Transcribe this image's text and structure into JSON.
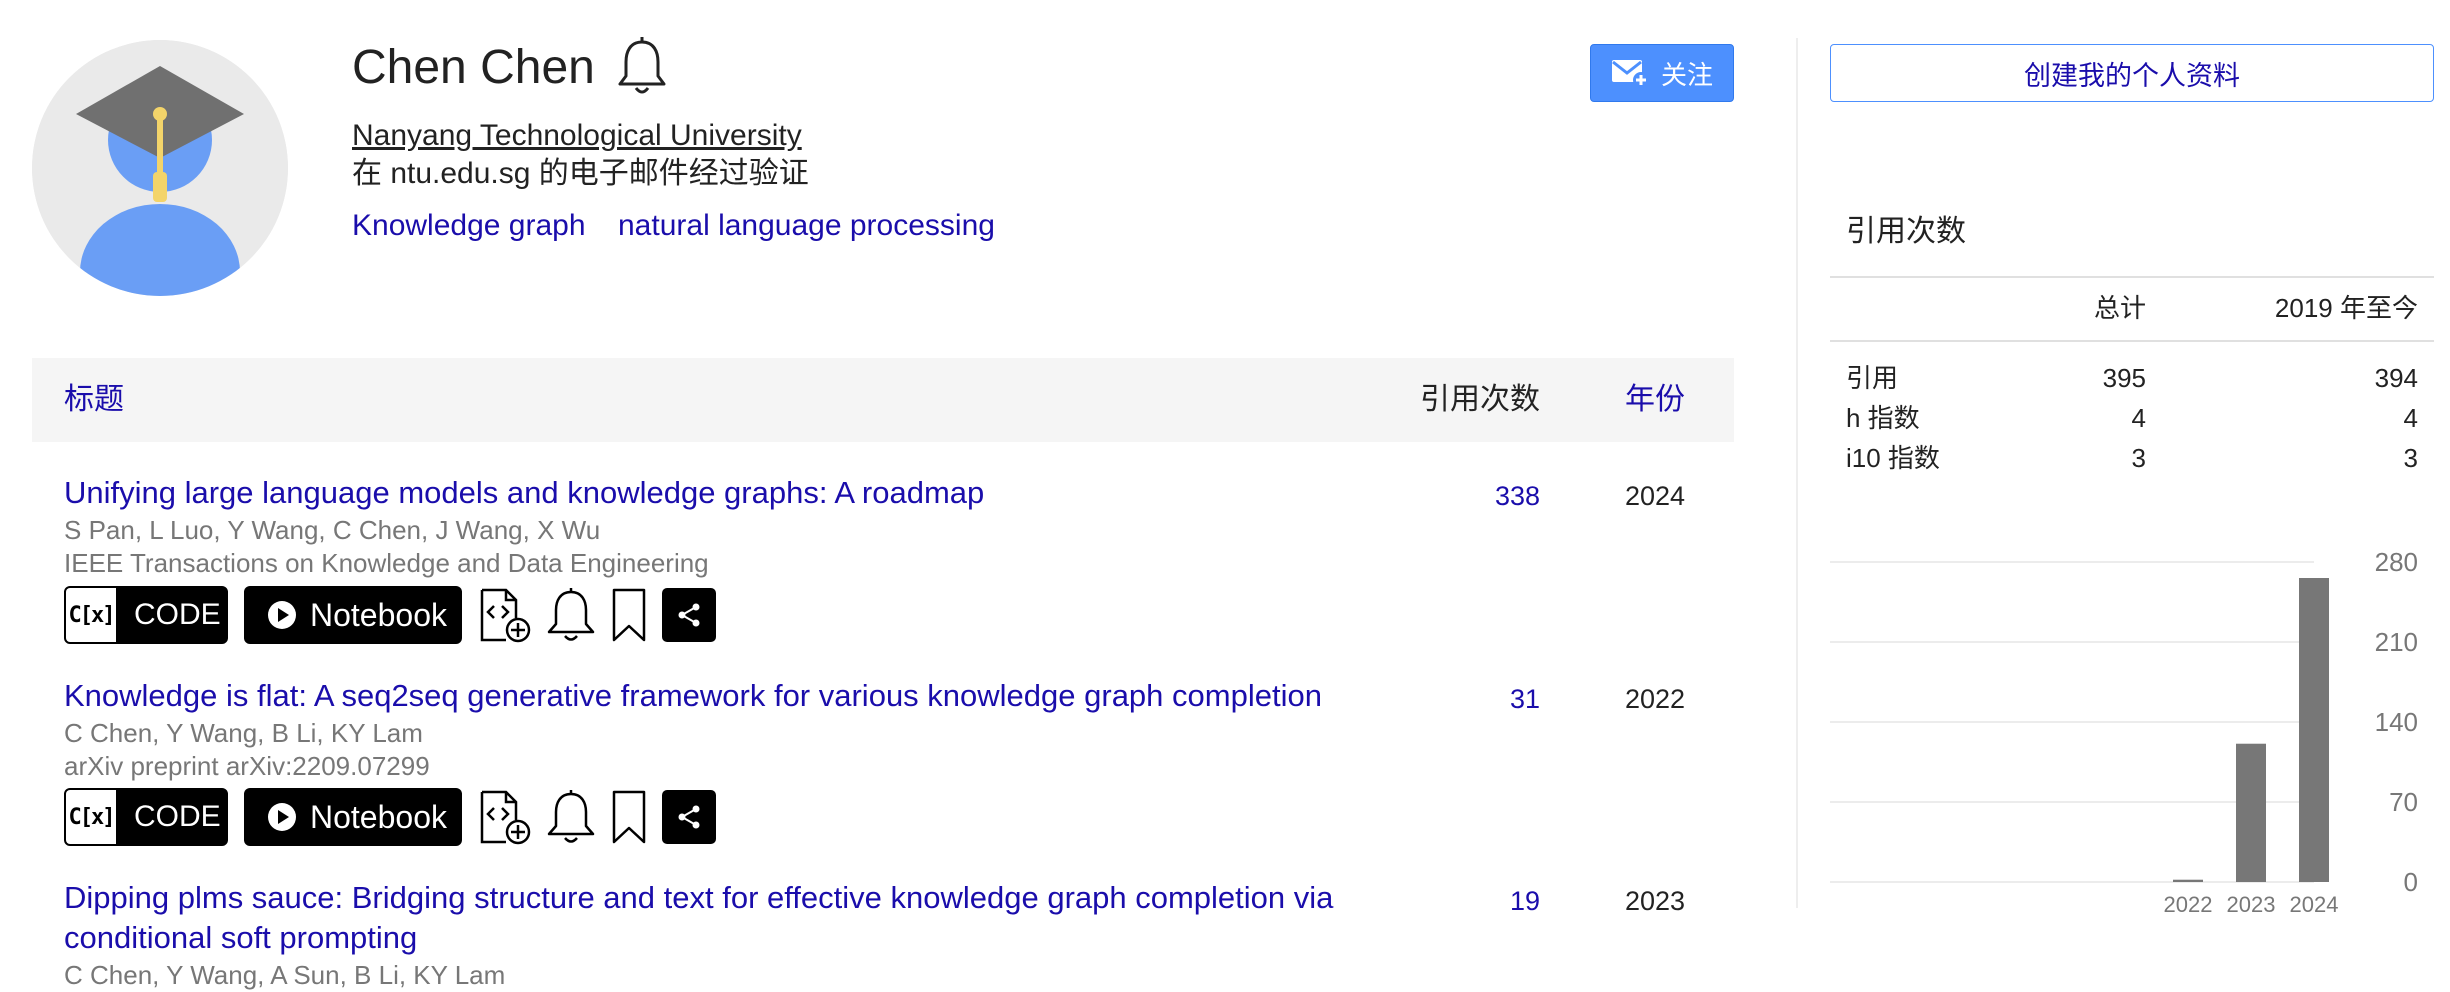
{
  "profile": {
    "name": "Chen Chen",
    "affiliation": "Nanyang Technological University",
    "verified_email": "在 ntu.edu.sg 的电子邮件经过验证",
    "interests": [
      "Knowledge graph",
      "natural language processing"
    ],
    "follow_label": "关注"
  },
  "table": {
    "header_title": "标题",
    "header_cited": "引用次数",
    "header_year": "年份"
  },
  "articles": [
    {
      "title": "Unifying large language models and knowledge graphs: A roadmap",
      "authors": "S Pan, L Luo, Y Wang, C Chen, J Wang, X Wu",
      "venue": "IEEE Transactions on Knowledge and Data Engineering",
      "cited_by": "338",
      "year": "2024"
    },
    {
      "title": "Knowledge is flat: A seq2seq generative framework for various knowledge graph completion",
      "authors": "C Chen, Y Wang, B Li, KY Lam",
      "venue": "arXiv preprint arXiv:2209.07299",
      "cited_by": "31",
      "year": "2022"
    },
    {
      "title": "Dipping plms sauce: Bridging structure and text for effective knowledge graph completion via conditional soft prompting",
      "authors": "C Chen, Y Wang, A Sun, B Li, KY Lam",
      "cited_by": "19",
      "year": "2023"
    }
  ],
  "badges": {
    "code_icon_text": "C[x]",
    "code_label": "CODE",
    "notebook_label": "Notebook"
  },
  "sidebar": {
    "create_profile_label": "创建我的个人资料",
    "stats_title": "引用次数",
    "col_all": "总计",
    "col_since": "2019 年至今",
    "rows": [
      {
        "label": "引用",
        "all": "395",
        "since": "394"
      },
      {
        "label": "h 指数",
        "all": "4",
        "since": "4"
      },
      {
        "label": "i10 指数",
        "all": "3",
        "since": "3"
      }
    ]
  },
  "colors": {
    "link": "#1a0dab",
    "follow_button": "#4d90fe",
    "bar": "#777777"
  },
  "icons": [
    "bell-icon",
    "follow-mail-icon",
    "embed-add-icon",
    "alert-bell-icon",
    "bookmark-icon",
    "share-icon"
  ],
  "chart_data": {
    "type": "bar",
    "categories": [
      "2022",
      "2023",
      "2024"
    ],
    "values": [
      2,
      121,
      266
    ],
    "yticks": [
      "280",
      "210",
      "140",
      "70",
      "0"
    ],
    "ylim": [
      0,
      280
    ],
    "grid": true
  }
}
